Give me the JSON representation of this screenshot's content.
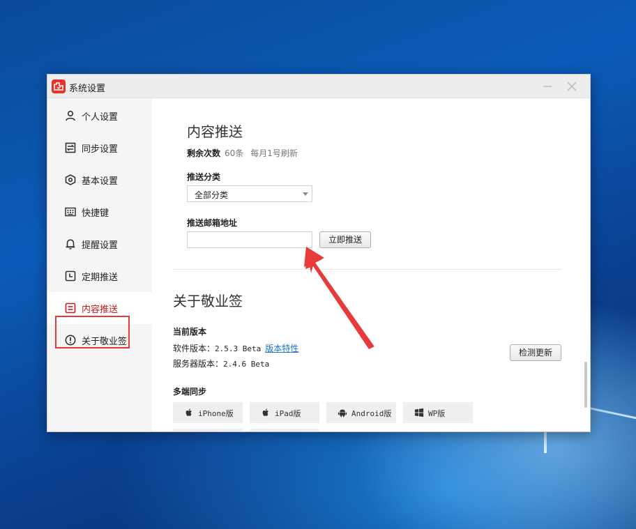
{
  "window": {
    "title": "系统设置"
  },
  "sidebar": {
    "items": [
      {
        "label": "个人设置",
        "icon": "user-icon"
      },
      {
        "label": "同步设置",
        "icon": "sync-icon"
      },
      {
        "label": "基本设置",
        "icon": "settings-icon"
      },
      {
        "label": "快捷键",
        "icon": "keyboard-icon"
      },
      {
        "label": "提醒设置",
        "icon": "bell-icon"
      },
      {
        "label": "定期推送",
        "icon": "schedule-icon"
      },
      {
        "label": "内容推送",
        "icon": "content-push-icon",
        "active": true
      },
      {
        "label": "关于敬业签",
        "icon": "info-icon"
      }
    ]
  },
  "content_push": {
    "title": "内容推送",
    "remaining_label": "剩余次数",
    "remaining_count": "60条",
    "refresh_note": "每月1号刷新",
    "category_label": "推送分类",
    "category_value": "全部分类",
    "email_label": "推送邮箱地址",
    "email_value": "",
    "push_button": "立即推送"
  },
  "about": {
    "title": "关于敬业签",
    "version_heading": "当前版本",
    "software_label": "软件版本：",
    "software_version": "2.5.3 Beta",
    "features_link": "版本特性",
    "server_label": "服务器版本：",
    "server_version": "2.4.6 Beta",
    "check_update_button": "检测更新",
    "sync_heading": "多端同步",
    "platforms": [
      {
        "label": "iPhone版",
        "icon": "apple-icon"
      },
      {
        "label": "iPad版",
        "icon": "apple-icon"
      },
      {
        "label": "Android版",
        "icon": "android-icon"
      },
      {
        "label": "WP版",
        "icon": "windows-icon"
      }
    ]
  },
  "colors": {
    "accent_red": "#e8322d",
    "active_text": "#c01a1a",
    "annotation_red": "#e83a3a",
    "link_blue": "#1a73c8"
  }
}
